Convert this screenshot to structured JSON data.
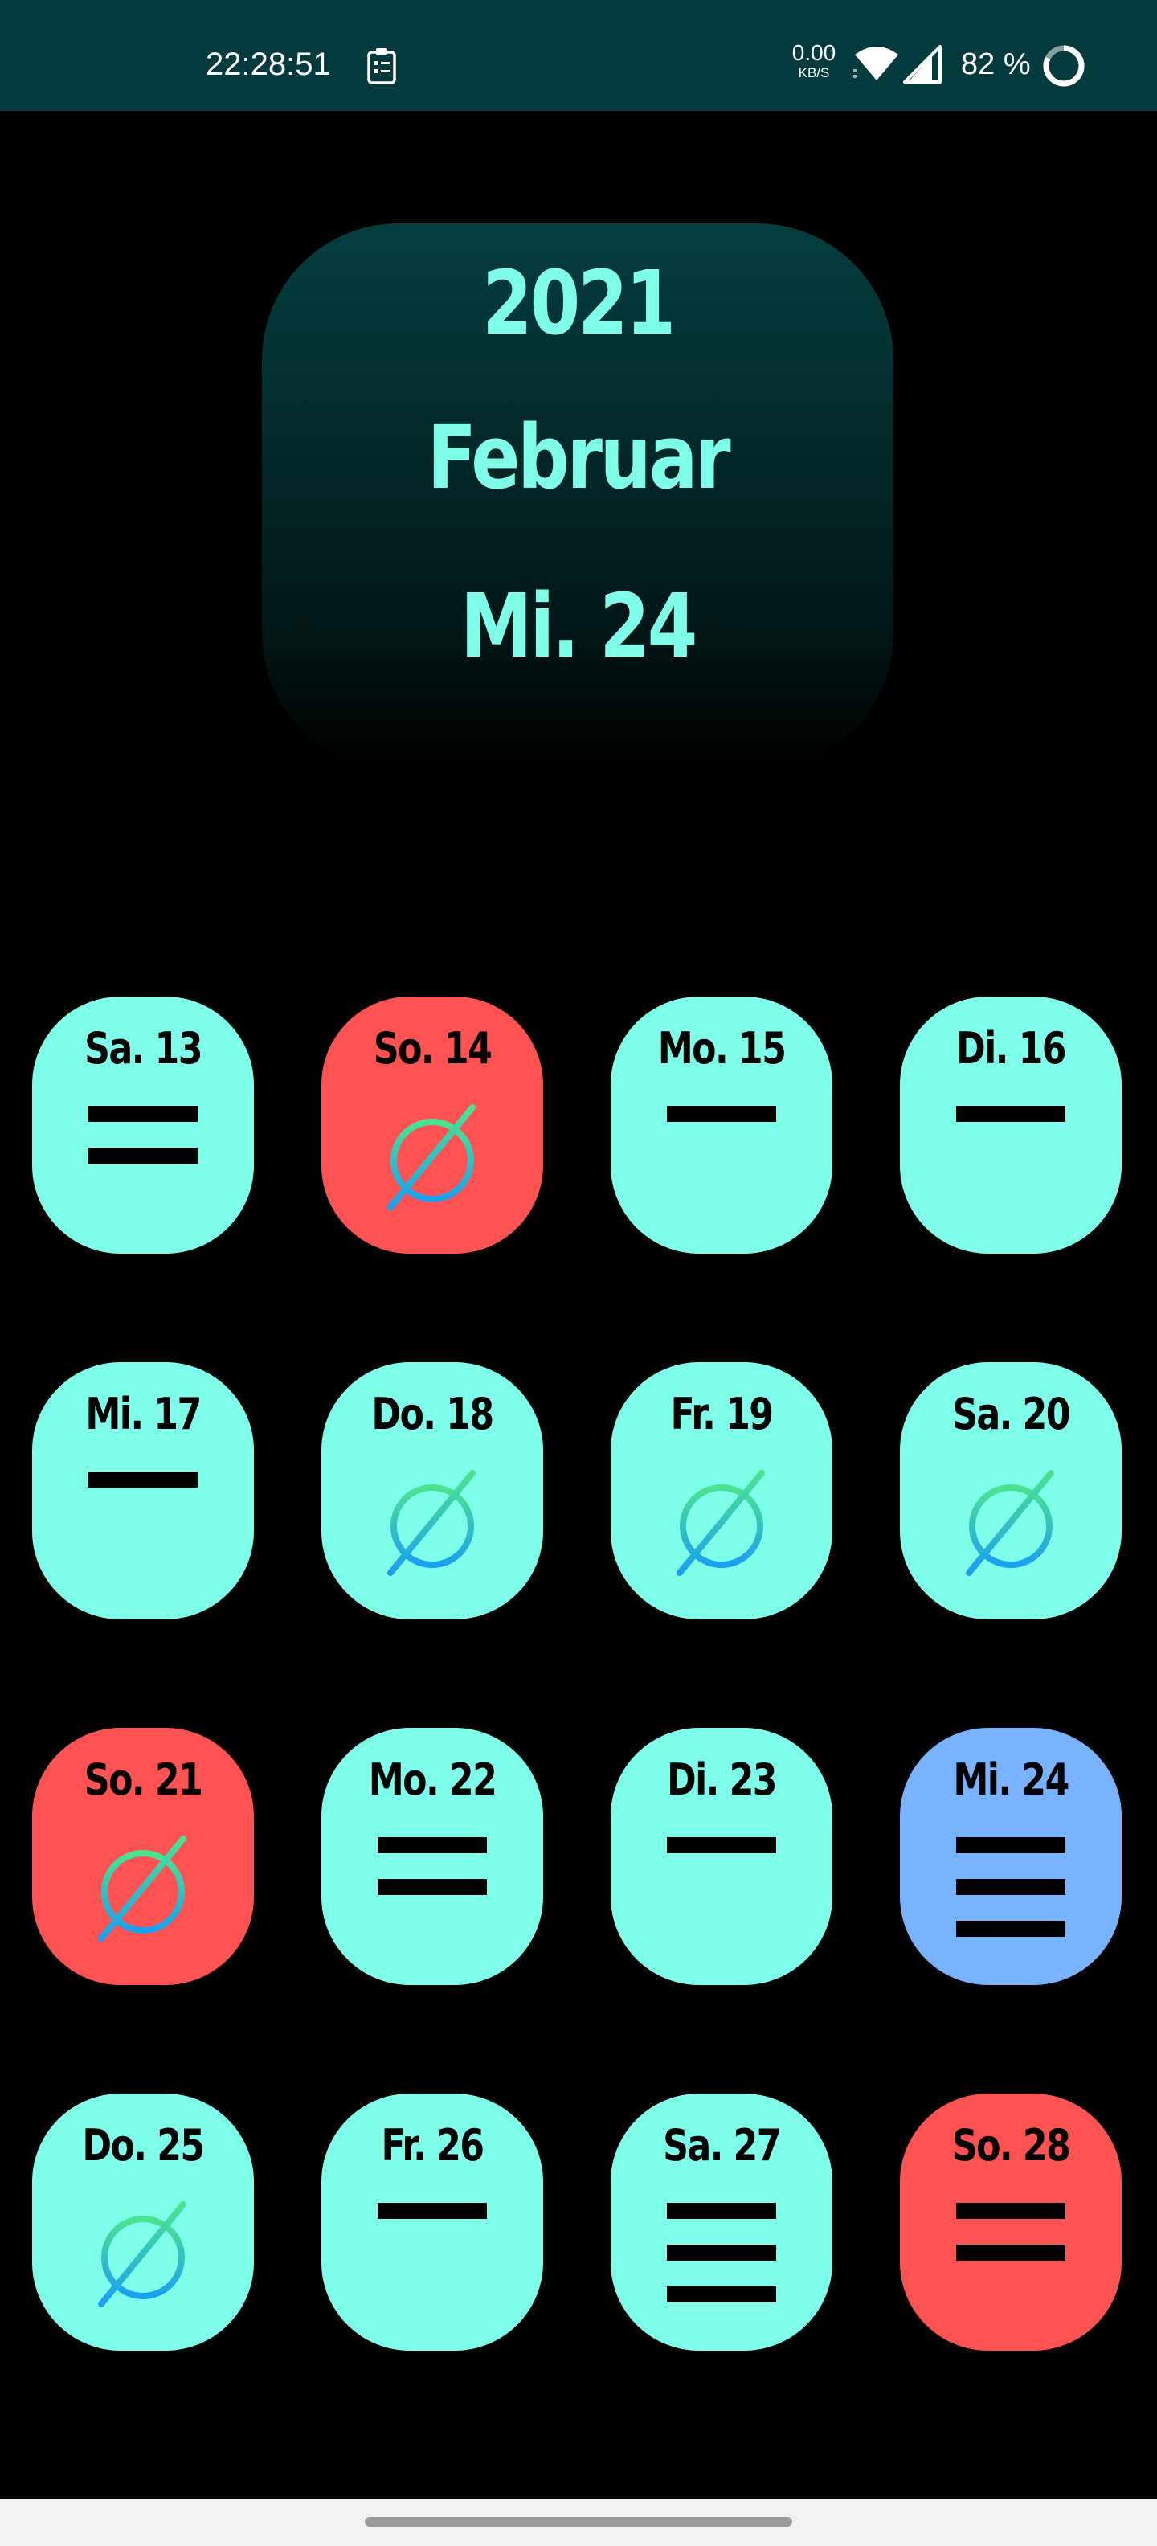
{
  "status_bar": {
    "time": "22:28:51",
    "net_speed": "0.00",
    "net_speed_unit": "KB/S",
    "battery": "82 %",
    "background": "#023a3e",
    "icons": [
      "clipboard-icon",
      "wifi-icon",
      "signal-icon",
      "battery-ring-icon"
    ]
  },
  "header": {
    "year": "2021",
    "month": "Februar",
    "day": "Mi. 24"
  },
  "colors": {
    "accent": "#7fffe9",
    "tile_default": "#7fffea",
    "tile_sunday": "#ff5353",
    "tile_today": "#79b2ff",
    "empty_icon_gradient": [
      "#4be38f",
      "#1aa0f0"
    ]
  },
  "days": [
    {
      "label": "Sa. 13",
      "kind": "default",
      "entries": 2
    },
    {
      "label": "So. 14",
      "kind": "sunday",
      "entries": 0
    },
    {
      "label": "Mo. 15",
      "kind": "default",
      "entries": 1
    },
    {
      "label": "Di. 16",
      "kind": "default",
      "entries": 1
    },
    {
      "label": "Mi. 17",
      "kind": "default",
      "entries": 1
    },
    {
      "label": "Do. 18",
      "kind": "default",
      "entries": 0
    },
    {
      "label": "Fr. 19",
      "kind": "default",
      "entries": 0
    },
    {
      "label": "Sa. 20",
      "kind": "default",
      "entries": 0
    },
    {
      "label": "So. 21",
      "kind": "sunday",
      "entries": 0
    },
    {
      "label": "Mo. 22",
      "kind": "default",
      "entries": 2
    },
    {
      "label": "Di. 23",
      "kind": "default",
      "entries": 1
    },
    {
      "label": "Mi. 24",
      "kind": "today",
      "entries": 3
    },
    {
      "label": "Do. 25",
      "kind": "default",
      "entries": 0
    },
    {
      "label": "Fr. 26",
      "kind": "default",
      "entries": 1
    },
    {
      "label": "Sa. 27",
      "kind": "default",
      "entries": 3
    },
    {
      "label": "So. 28",
      "kind": "sunday",
      "entries": 2
    }
  ]
}
